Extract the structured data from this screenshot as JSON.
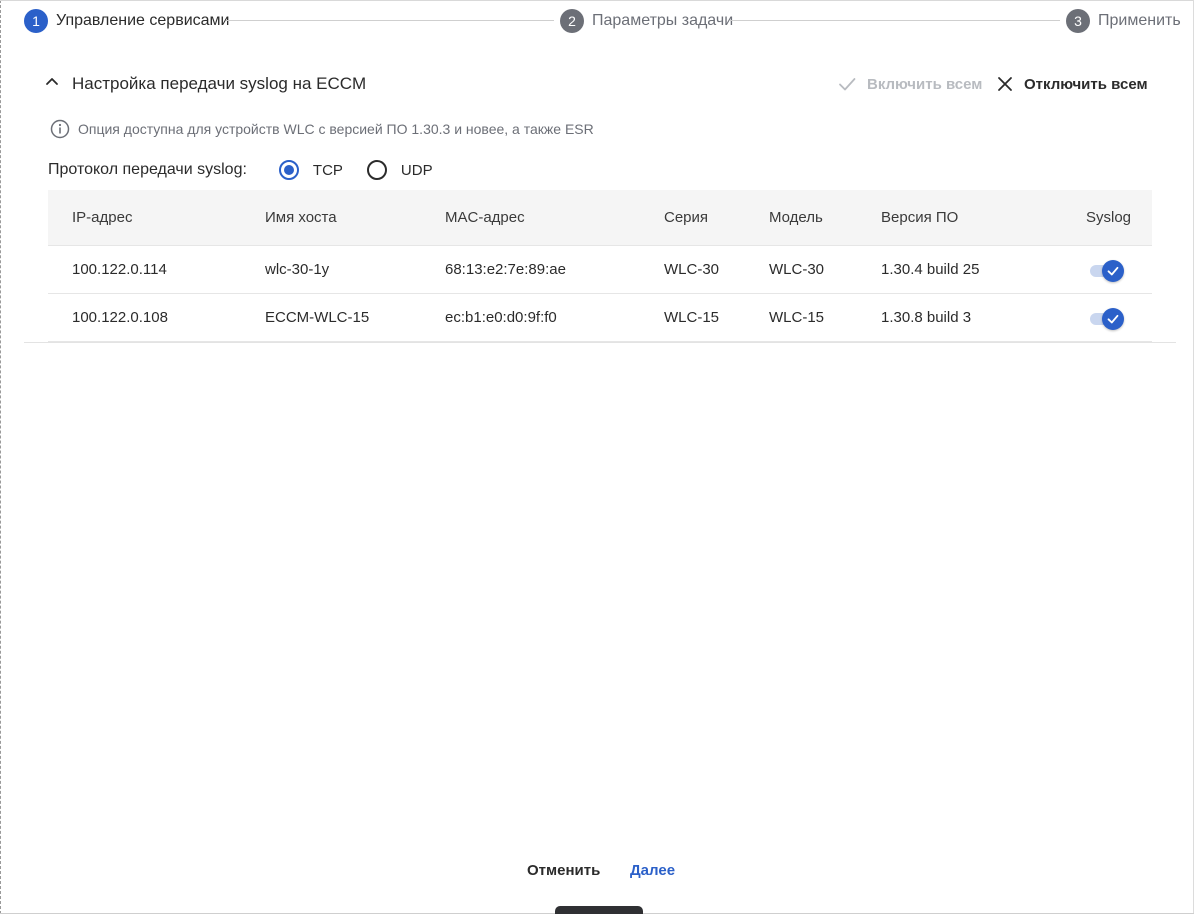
{
  "stepper": {
    "steps": [
      {
        "num": "1",
        "label": "Управление сервисами"
      },
      {
        "num": "2",
        "label": "Параметры задачи"
      },
      {
        "num": "3",
        "label": "Применить"
      }
    ]
  },
  "panel": {
    "title": "Настройка передачи syslog на ECCM",
    "enable_all": "Включить всем",
    "disable_all": "Отключить всем",
    "info": "Опция доступна для устройств WLC с версией ПО 1.30.3 и новее, а также ESR",
    "protocol_label": "Протокол передачи syslog:",
    "protocol_options": [
      "TCP",
      "UDP"
    ],
    "protocol_selected": "TCP"
  },
  "table": {
    "headers": [
      "IP-адрес",
      "Имя хоста",
      "MAC-адрес",
      "Серия",
      "Модель",
      "Версия ПО",
      "Syslog"
    ],
    "rows": [
      {
        "ip": "100.122.0.114",
        "host": "wlc-30-1y",
        "mac": "68:13:e2:7e:89:ae",
        "series": "WLC-30",
        "model": "WLC-30",
        "version": "1.30.4 build 25",
        "syslog": true
      },
      {
        "ip": "100.122.0.108",
        "host": "ECCM-WLC-15",
        "mac": "ec:b1:e0:d0:9f:f0",
        "series": "WLC-15",
        "model": "WLC-15",
        "version": "1.30.8 build 3",
        "syslog": true
      }
    ]
  },
  "footer": {
    "cancel": "Отменить",
    "next": "Далее"
  },
  "colors": {
    "accent": "#2b60c9",
    "muted": "#6c6f77",
    "disabled": "#b8bbc0"
  }
}
